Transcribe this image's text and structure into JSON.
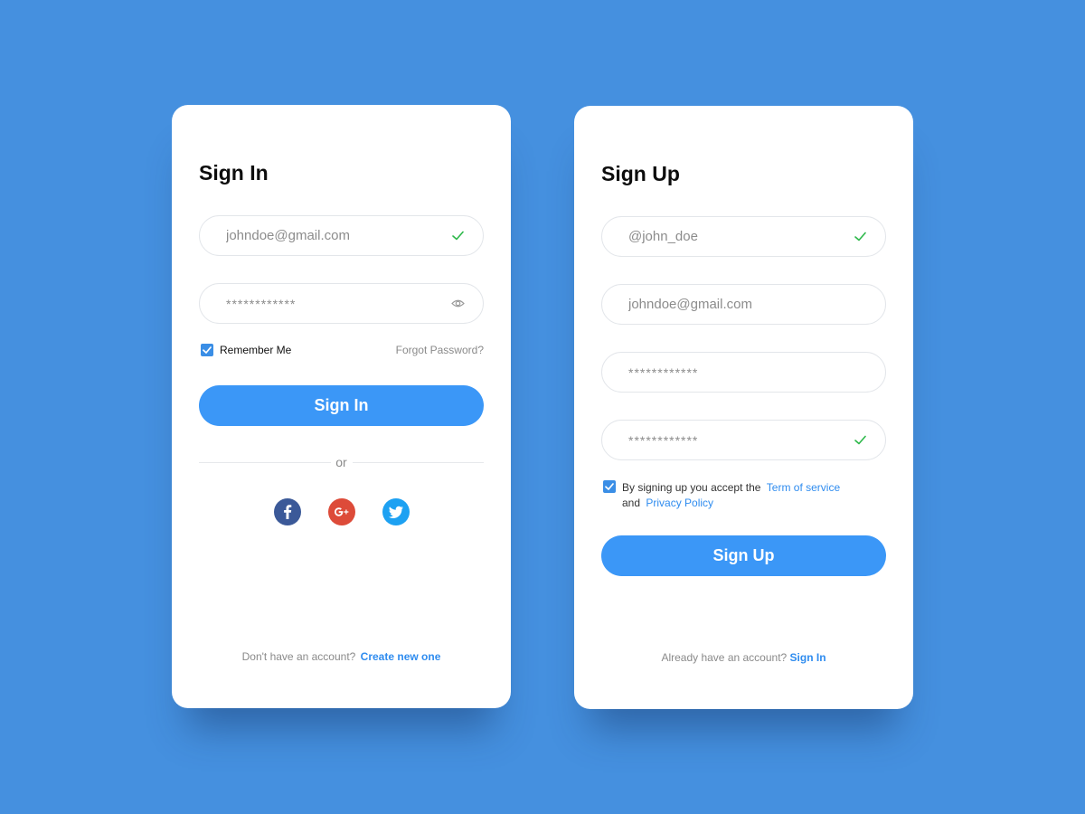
{
  "signin": {
    "title": "Sign In",
    "email_value": "johndoe@gmail.com",
    "password_value": "************",
    "remember_label": "Remember Me",
    "remember_checked": true,
    "forgot_label": "Forgot Password?",
    "button_label": "Sign In",
    "divider_label": "or",
    "social": [
      "facebook-icon",
      "google-plus-icon",
      "twitter-icon"
    ],
    "footer_text": "Don't have an account?",
    "footer_link": "Create new one"
  },
  "signup": {
    "title": "Sign Up",
    "username_value": "@john_doe",
    "email_value": "johndoe@gmail.com",
    "password_value": "************",
    "confirm_password_value": "************",
    "terms_checked": true,
    "terms_prefix": "By signing up you accept the",
    "terms_link": "Term of service",
    "terms_and": "and",
    "privacy_link": "Privacy Policy",
    "button_label": "Sign Up",
    "footer_text": "Already have an account?",
    "footer_link": "Sign In"
  },
  "colors": {
    "background": "#4590df",
    "primary_button": "#3b97f7",
    "link": "#2f8cef",
    "valid_check": "#2db84a",
    "facebook": "#3b5998",
    "google": "#dd4b39",
    "twitter": "#1da1f2"
  }
}
